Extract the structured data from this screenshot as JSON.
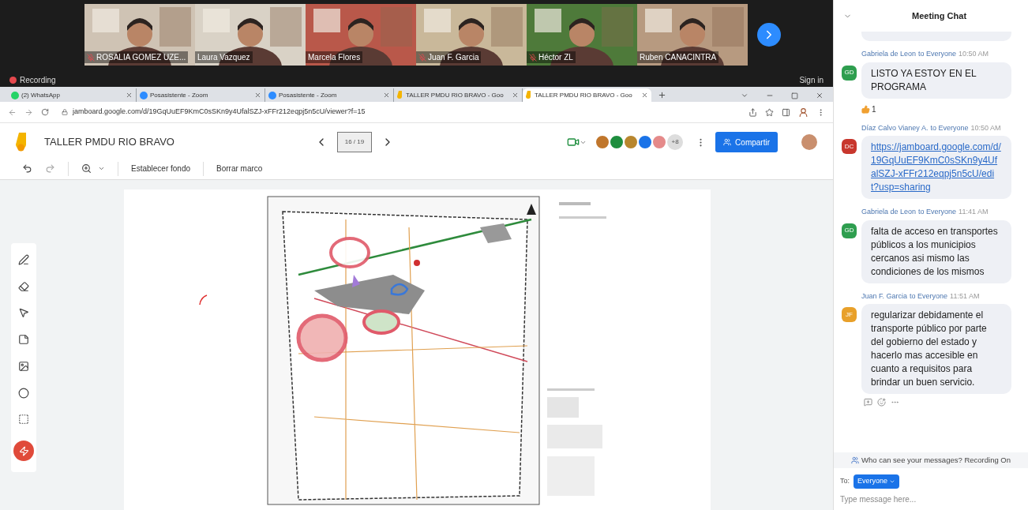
{
  "meeting": {
    "participants": [
      {
        "name": "ROSALIA GOMEZ UZE...",
        "muted": true
      },
      {
        "name": "Laura Vazquez",
        "muted": false
      },
      {
        "name": "Marcela Flores",
        "muted": false
      },
      {
        "name": "Juan F. Garcia",
        "muted": true
      },
      {
        "name": "Héctor ZL",
        "muted": true
      },
      {
        "name": "Ruben CANACINTRA",
        "muted": false
      }
    ],
    "recording": "Recording",
    "sign_in": "Sign in"
  },
  "browser": {
    "tabs": [
      {
        "title": "(2) WhatsApp",
        "kind": "whatsapp",
        "selected": false
      },
      {
        "title": "Posasistente - Zoom",
        "kind": "zoom",
        "selected": false
      },
      {
        "title": "Posasistente - Zoom",
        "kind": "zoom",
        "selected": false
      },
      {
        "title": "TALLER PMDU RIO BRAVO - Goo",
        "kind": "jamboard",
        "selected": false
      },
      {
        "title": "TALLER PMDU RIO BRAVO - Goo",
        "kind": "jamboard",
        "selected": true
      }
    ],
    "url": "jamboard.google.com/d/19GqUuEF9KmC0sSKn9y4UfalSZJ-xFFr212eqpj5n5cU/viewer?f=15"
  },
  "jamboard": {
    "title": "TALLER PMDU RIO BRAVO",
    "frame_counter": "16 / 19",
    "collaborators": [
      {
        "color": "#c0762c"
      },
      {
        "color": "#1e8e3e"
      },
      {
        "color": "#b8862e"
      },
      {
        "color": "#1a73e8"
      },
      {
        "color": "#e58a8a"
      }
    ],
    "extra_count": "+8",
    "share": "Compartir",
    "toolbar": [
      "Establecer fondo",
      "Borrar marco"
    ]
  },
  "chat": {
    "title": "Meeting Chat",
    "messages": [
      {
        "initials": "GD",
        "color": "#2e9e4f",
        "sender": "Gabriela de Leon",
        "audience": "to Everyone",
        "time": "10:50 AM",
        "kind": "text",
        "text": "LISTO YA ESTOY EN EL PROGRAMA",
        "reactions": [
          {
            "count": "1"
          }
        ],
        "hovered": false
      },
      {
        "initials": "DC",
        "color": "#c8372d",
        "sender": "Díaz Calvo Vianey A.",
        "audience": "to Everyone",
        "time": "10:50 AM",
        "kind": "link",
        "text": "https://jamboard.google.com/d/19GqUuEF9KmC0sSKn9y4UfalSZJ-xFFr212eqpj5n5cU/edit?usp=sharing",
        "hovered": false
      },
      {
        "initials": "GD",
        "color": "#2e9e4f",
        "sender": "Gabriela de Leon",
        "audience": "to Everyone",
        "time": "11:41 AM",
        "kind": "text",
        "text": "falta de acceso en transportes públicos a los municipios cercanos asi mismo las condiciones de los mismos",
        "hovered": false
      },
      {
        "initials": "JF",
        "color": "#e8a02a",
        "sender": "Juan F. Garcia",
        "audience": "to Everyone",
        "time": "11:51 AM",
        "kind": "text",
        "text": "regularizar debidamente el transporte público por parte del gobierno del estado y hacerlo mas accesible en cuanto a requisitos para brindar un buen servicio.",
        "hovered": true
      }
    ],
    "privacy": "Who can see your messages? Recording On",
    "to_label": "To:",
    "recipient": "Everyone",
    "placeholder": "Type message here..."
  }
}
